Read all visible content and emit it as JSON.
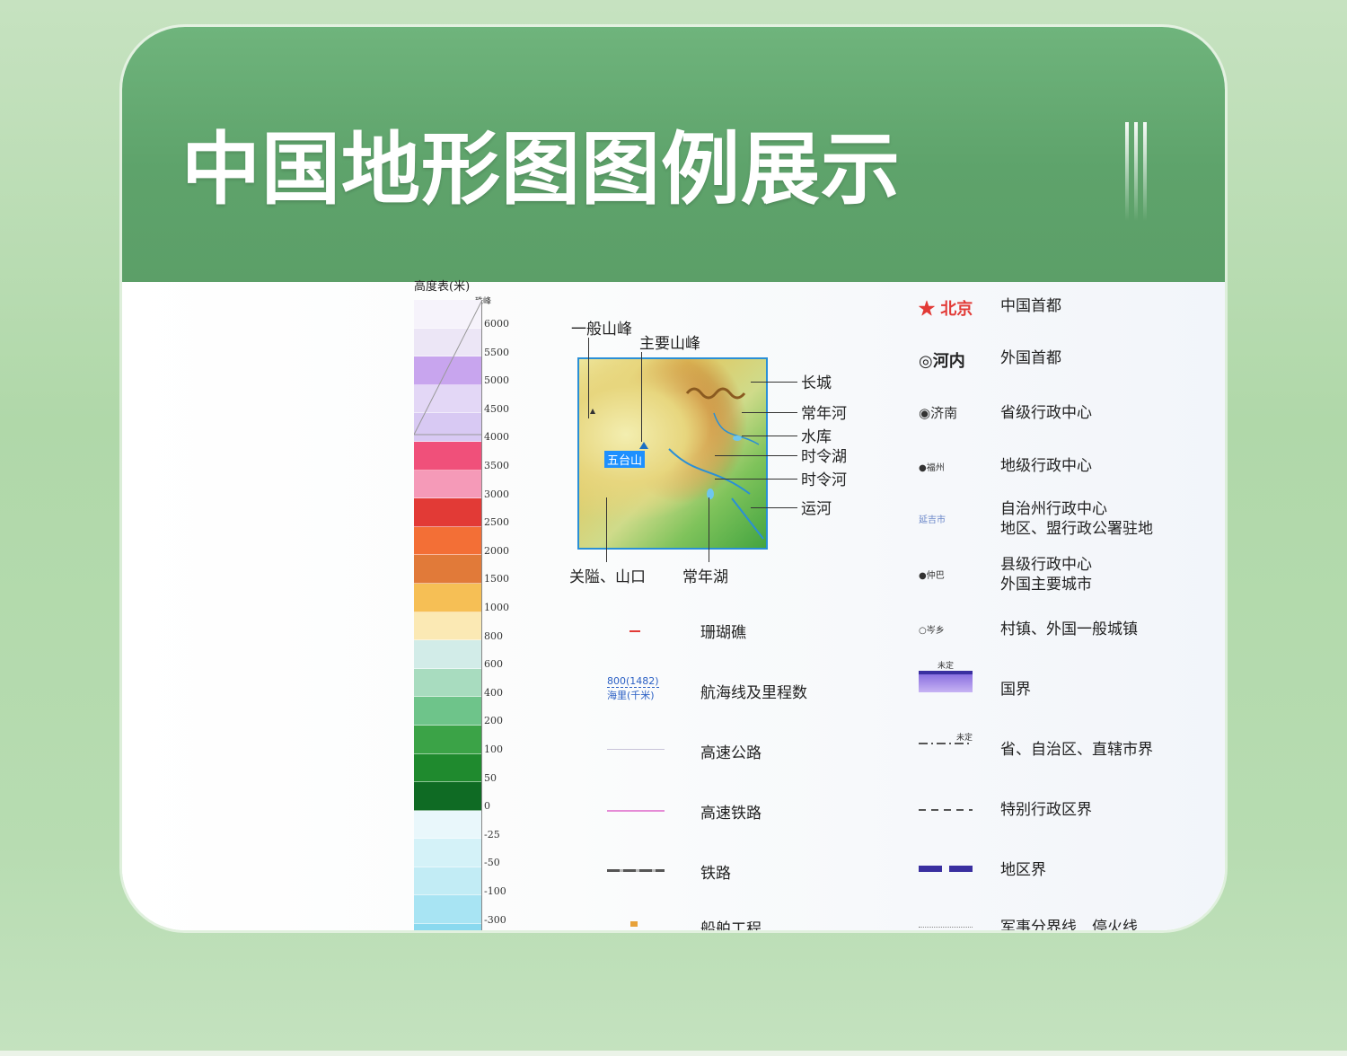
{
  "header": {
    "title": "中国地形图图例展示"
  },
  "elevation": {
    "title": "高度表(米)",
    "top_label": "珠峰",
    "bands": [
      {
        "color": "#f6f3fb",
        "label": "6000"
      },
      {
        "color": "#ece6f6",
        "label": "5500"
      },
      {
        "color": "#c8a5ee",
        "label": "5000"
      },
      {
        "color": "#e3d7f6",
        "label": "4500"
      },
      {
        "color": "#d8c9f3",
        "label": "4000"
      },
      {
        "color": "#f0507a",
        "label": "3500"
      },
      {
        "color": "#f59ab8",
        "label": "3000"
      },
      {
        "color": "#e23a36",
        "label": "2500"
      },
      {
        "color": "#f36f36",
        "label": "2000"
      },
      {
        "color": "#e17a39",
        "label": "1500"
      },
      {
        "color": "#f6bf55",
        "label": "1000"
      },
      {
        "color": "#fbe9b4",
        "label": "800"
      },
      {
        "color": "#d2ece8",
        "label": "600"
      },
      {
        "color": "#a8dcbf",
        "label": "400"
      },
      {
        "color": "#6ec48a",
        "label": "200"
      },
      {
        "color": "#3ba347",
        "label": "100"
      },
      {
        "color": "#1f8a2e",
        "label": "50"
      },
      {
        "color": "#0f6b24",
        "label": "0"
      },
      {
        "color": "#e9f7fb",
        "label": "-25"
      },
      {
        "color": "#d4f2f8",
        "label": "-50"
      },
      {
        "color": "#c2ecf5",
        "label": "-100"
      },
      {
        "color": "#a8e4f3",
        "label": "-300"
      },
      {
        "color": "#8ad9ef",
        "label": ""
      }
    ]
  },
  "map_annotations": {
    "general_peak": "一般山峰",
    "main_peak": "主要山峰",
    "great_wall": "长城",
    "perennial_river": "常年河",
    "reservoir": "水库",
    "seasonal_lake": "时令湖",
    "seasonal_river": "时令河",
    "canal": "运河",
    "pass": "关隘、山口",
    "perennial_lake": "常年湖",
    "mountain_name": "五台山"
  },
  "middle_legend": [
    {
      "label": "珊瑚礁",
      "symbol": "coral"
    },
    {
      "label": "航海线及里程数",
      "symbol": "sea-route",
      "sym_text1": "800(1482)",
      "sym_text2": "海里(千米)"
    },
    {
      "label": "高速公路",
      "symbol": "expressway"
    },
    {
      "label": "高速铁路",
      "symbol": "high-speed-rail"
    },
    {
      "label": "铁路",
      "symbol": "railway"
    },
    {
      "label": "船舶工程",
      "symbol": "ship"
    }
  ],
  "right_legend": [
    {
      "symbol_text": "★ 北京",
      "label": "中国首都",
      "color": "#e23a36"
    },
    {
      "symbol_text": "◎河内",
      "label": "外国首都",
      "color": "#d16ac8"
    },
    {
      "symbol_text": "◉济南",
      "label": "省级行政中心",
      "color": "#333333"
    },
    {
      "symbol_text": "●福州",
      "label": "地级行政中心",
      "color": "#333333"
    },
    {
      "symbol_text": "延吉市",
      "label": "自治州行政中心",
      "label2": "地区、盟行政公署驻地",
      "color": "#333333"
    },
    {
      "symbol_text": "●仲巴",
      "label": "县级行政中心",
      "label2": "外国主要城市",
      "color": "#333333"
    },
    {
      "symbol_text": "○岑乡",
      "label": "村镇、外国一般城镇",
      "color": "#333333"
    },
    {
      "symbol_text": "未定",
      "label": "国界",
      "color": "#6b5bd6"
    },
    {
      "symbol_text": "未定",
      "label": "省、自治区、直辖市界",
      "color": "#333333"
    },
    {
      "symbol_text": "",
      "label": "特别行政区界",
      "color": "#333333"
    },
    {
      "symbol_text": "",
      "label": "地区界",
      "color": "#3a2fa0"
    },
    {
      "symbol_text": "",
      "label": "军事分界线　停火线",
      "color": "#333333"
    }
  ]
}
